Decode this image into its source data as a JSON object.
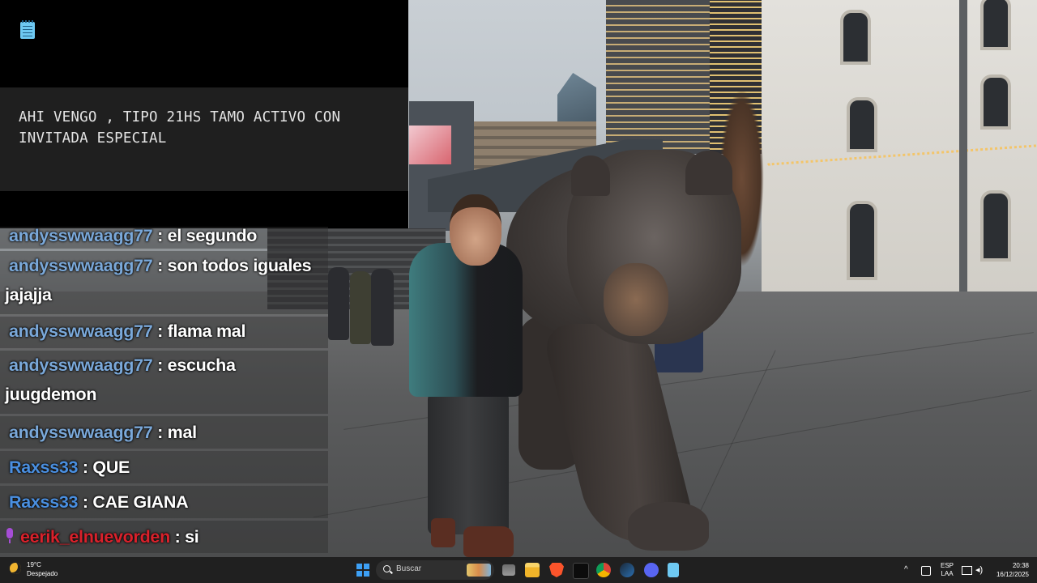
{
  "notepad": {
    "icon": "notepad-icon",
    "text": "AHI VENGO , TIPO 21HS TAMO ACTIVO CON\nINVITADA ESPECIAL"
  },
  "chat": {
    "messages": [
      {
        "user": "andysswwaagg77",
        "sep": " : ",
        "text": "el segundo",
        "color": "#7aa8d9"
      },
      {
        "user": "andysswwaagg77",
        "sep": " : ",
        "text": "son todos iguales jajajja",
        "color": "#7aa8d9"
      },
      {
        "user": "andysswwaagg77",
        "sep": " : ",
        "text": "flama mal",
        "color": "#7aa8d9"
      },
      {
        "user": "andysswwaagg77",
        "sep": " : ",
        "text": "escucha juugdemon",
        "color": "#7aa8d9"
      },
      {
        "user": "andysswwaagg77",
        "sep": " : ",
        "text": "mal",
        "color": "#7aa8d9"
      },
      {
        "user": "Raxss33",
        "sep": " : ",
        "text": "QUE",
        "color": "#4a8fe0"
      },
      {
        "user": "Raxss33",
        "sep": " : ",
        "text": "CAE GIANA",
        "color": "#4a8fe0"
      },
      {
        "user": "eerik_elnuevorden",
        "sep": " : ",
        "text": "si",
        "color": "#d9212b",
        "badge": "microphone-icon"
      }
    ]
  },
  "taskbar": {
    "weather": {
      "temp": "19°C",
      "desc": "Despejado",
      "icon": "moon-icon"
    },
    "search_label": "Buscar",
    "apps": [
      "start-icon",
      "search-icon",
      "photo-app-icon",
      "task-view-icon",
      "file-explorer-icon",
      "brave-icon",
      "terminal-icon",
      "chrome-icon",
      "steam-icon",
      "discord-icon",
      "notepad-icon"
    ],
    "tray": {
      "lang1": "ESP",
      "lang2": "LAA"
    },
    "clock": {
      "time": "20:38",
      "date": "16/12/2025"
    }
  }
}
